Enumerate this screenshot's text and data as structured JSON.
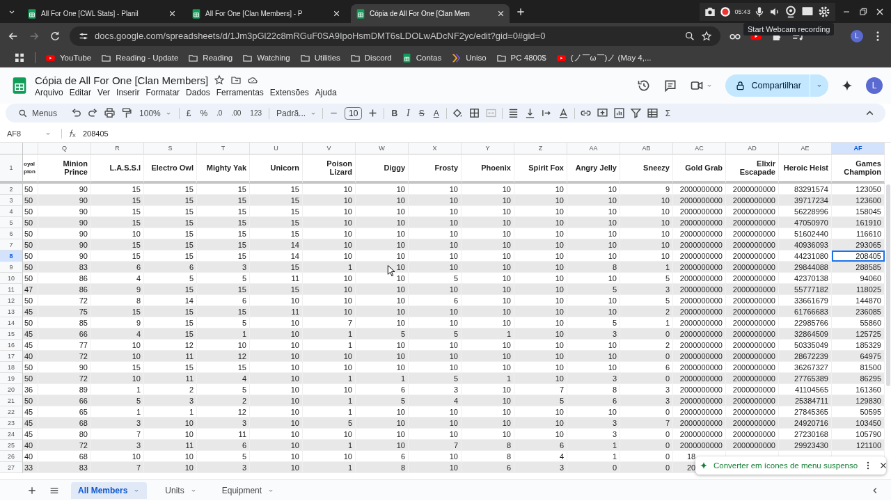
{
  "browser": {
    "tabs": [
      {
        "title": "All For One [CWL Stats] - Planil",
        "selected": false
      },
      {
        "title": "All For One [Clan Members] - P",
        "selected": false
      },
      {
        "title": "Cópia de All For One [Clan Mem",
        "selected": true
      }
    ],
    "recorder_time": "05:43",
    "tooltip": "Start Webcam recording",
    "url": "docs.google.com/spreadsheets/d/1Jm3pGl22c8mRGuF0SA9IpoHsmDMT6sLDOLwADcNF2yc/edit?gid=0#gid=0",
    "profile": "L",
    "bookmarks": [
      {
        "label": "YouTube",
        "kind": "youtube"
      },
      {
        "label": "Reading - Update",
        "kind": "folder"
      },
      {
        "label": "Reading",
        "kind": "folder"
      },
      {
        "label": "Watching",
        "kind": "folder"
      },
      {
        "label": "Utilities",
        "kind": "folder"
      },
      {
        "label": "Discord",
        "kind": "folder"
      },
      {
        "label": "Contas",
        "kind": "sheets"
      },
      {
        "label": "Uniso",
        "kind": "chevron"
      },
      {
        "label": "PC 4800$",
        "kind": "folder"
      },
      {
        "label": "(ノ￣ω￣)ノ (May 4,...",
        "kind": "youtube"
      }
    ]
  },
  "doc": {
    "title": "Cópia de All For One [Clan Members]",
    "menu": [
      "Arquivo",
      "Editar",
      "Ver",
      "Inserir",
      "Formatar",
      "Dados",
      "Ferramentas",
      "Extensões",
      "Ajuda"
    ],
    "share": "Compartilhar",
    "avatar": "L"
  },
  "toolbar": {
    "search": "Menus",
    "zoom": "100%",
    "currency": "£",
    "percent": "%",
    "dec_less": ".0",
    "dec_more": ".00",
    "number_format": "123",
    "font": "Padrã...",
    "font_size": "10",
    "bold": "B",
    "italic": "I",
    "strike": "S",
    "text_color": "A",
    "sum": "Σ"
  },
  "formula_bar": {
    "cell": "AF8",
    "value": "208405"
  },
  "table": {
    "columns": [
      {
        "header": "oyal pion",
        "selected": false
      },
      {
        "letter": "Q",
        "header": "Minion Prince",
        "selected": false
      },
      {
        "letter": "R",
        "header": "L.A.S.S.I",
        "selected": false
      },
      {
        "letter": "S",
        "header": "Electro Owl",
        "selected": false
      },
      {
        "letter": "T",
        "header": "Mighty Yak",
        "selected": false
      },
      {
        "letter": "U",
        "header": "Unicorn",
        "selected": false
      },
      {
        "letter": "V",
        "header": "Poison Lizard",
        "selected": false
      },
      {
        "letter": "W",
        "header": "Diggy",
        "selected": false
      },
      {
        "letter": "X",
        "header": "Frosty",
        "selected": false
      },
      {
        "letter": "Y",
        "header": "Phoenix",
        "selected": false
      },
      {
        "letter": "Z",
        "header": "Spirit Fox",
        "selected": false
      },
      {
        "letter": "AA",
        "header": "Angry Jelly",
        "selected": false
      },
      {
        "letter": "AB",
        "header": "Sneezy",
        "selected": false
      },
      {
        "letter": "AC",
        "header": "Gold Grab",
        "selected": false
      },
      {
        "letter": "AD",
        "header": "Elixir Escapade",
        "selected": false
      },
      {
        "letter": "AE",
        "header": "Heroic Heist",
        "selected": false
      },
      {
        "letter": "AF",
        "header": "Games Champion",
        "selected": true
      }
    ],
    "header_row": "1",
    "rows": [
      {
        "number": "2",
        "selected": false,
        "cells": [
          "50",
          "90",
          "15",
          "15",
          "15",
          "15",
          "10",
          "10",
          "10",
          "10",
          "10",
          "10",
          "9",
          "2000000000",
          "2000000000",
          "83291574",
          "123050"
        ]
      },
      {
        "number": "3",
        "selected": false,
        "cells": [
          "50",
          "90",
          "15",
          "15",
          "15",
          "15",
          "10",
          "10",
          "10",
          "10",
          "10",
          "10",
          "10",
          "2000000000",
          "2000000000",
          "39717234",
          "123600"
        ]
      },
      {
        "number": "4",
        "selected": false,
        "cells": [
          "50",
          "90",
          "15",
          "15",
          "15",
          "15",
          "10",
          "10",
          "10",
          "10",
          "10",
          "10",
          "10",
          "2000000000",
          "2000000000",
          "56228996",
          "158045"
        ]
      },
      {
        "number": "5",
        "selected": false,
        "cells": [
          "50",
          "90",
          "15",
          "15",
          "15",
          "15",
          "10",
          "10",
          "10",
          "10",
          "10",
          "10",
          "10",
          "2000000000",
          "2000000000",
          "47050970",
          "161910"
        ]
      },
      {
        "number": "6",
        "selected": false,
        "cells": [
          "50",
          "90",
          "10",
          "15",
          "15",
          "15",
          "10",
          "10",
          "10",
          "10",
          "10",
          "10",
          "10",
          "2000000000",
          "2000000000",
          "51602440",
          "116610"
        ]
      },
      {
        "number": "7",
        "selected": false,
        "cells": [
          "50",
          "90",
          "15",
          "15",
          "15",
          "14",
          "10",
          "10",
          "10",
          "10",
          "10",
          "10",
          "10",
          "2000000000",
          "2000000000",
          "40936093",
          "293065"
        ]
      },
      {
        "number": "8",
        "selected": true,
        "cells": [
          "50",
          "90",
          "15",
          "15",
          "15",
          "14",
          "10",
          "10",
          "10",
          "10",
          "10",
          "10",
          "10",
          "2000000000",
          "2000000000",
          "44231080",
          "208405"
        ]
      },
      {
        "number": "9",
        "selected": false,
        "cells": [
          "50",
          "83",
          "6",
          "6",
          "3",
          "15",
          "1",
          "10",
          "10",
          "10",
          "10",
          "8",
          "1",
          "2000000000",
          "2000000000",
          "29844088",
          "288585"
        ]
      },
      {
        "number": "10",
        "selected": false,
        "cells": [
          "50",
          "86",
          "4",
          "5",
          "5",
          "11",
          "10",
          "10",
          "5",
          "10",
          "10",
          "10",
          "5",
          "2000000000",
          "2000000000",
          "42370138",
          "94060"
        ]
      },
      {
        "number": "11",
        "selected": false,
        "cells": [
          "47",
          "86",
          "9",
          "15",
          "15",
          "15",
          "10",
          "10",
          "10",
          "10",
          "10",
          "5",
          "3",
          "2000000000",
          "2000000000",
          "55777182",
          "118025"
        ]
      },
      {
        "number": "12",
        "selected": false,
        "cells": [
          "50",
          "72",
          "8",
          "14",
          "6",
          "10",
          "10",
          "10",
          "6",
          "10",
          "10",
          "10",
          "5",
          "2000000000",
          "2000000000",
          "33661679",
          "144870"
        ]
      },
      {
        "number": "13",
        "selected": false,
        "cells": [
          "45",
          "75",
          "15",
          "15",
          "15",
          "11",
          "10",
          "10",
          "10",
          "10",
          "10",
          "10",
          "2",
          "2000000000",
          "2000000000",
          "61766683",
          "236085"
        ]
      },
      {
        "number": "14",
        "selected": false,
        "cells": [
          "50",
          "85",
          "9",
          "15",
          "5",
          "10",
          "7",
          "10",
          "10",
          "10",
          "10",
          "5",
          "1",
          "2000000000",
          "2000000000",
          "22985766",
          "55860"
        ]
      },
      {
        "number": "15",
        "selected": false,
        "cells": [
          "45",
          "66",
          "4",
          "15",
          "1",
          "10",
          "1",
          "5",
          "5",
          "1",
          "10",
          "3",
          "0",
          "2000000000",
          "2000000000",
          "32864509",
          "125725"
        ]
      },
      {
        "number": "16",
        "selected": false,
        "cells": [
          "45",
          "77",
          "10",
          "12",
          "10",
          "10",
          "1",
          "10",
          "10",
          "10",
          "10",
          "10",
          "2",
          "2000000000",
          "2000000000",
          "50335049",
          "185329"
        ]
      },
      {
        "number": "17",
        "selected": false,
        "cells": [
          "40",
          "72",
          "10",
          "11",
          "12",
          "10",
          "10",
          "10",
          "10",
          "10",
          "10",
          "10",
          "0",
          "2000000000",
          "2000000000",
          "28672239",
          "64975"
        ]
      },
      {
        "number": "18",
        "selected": false,
        "cells": [
          "50",
          "90",
          "15",
          "15",
          "15",
          "10",
          "10",
          "10",
          "10",
          "10",
          "10",
          "10",
          "6",
          "2000000000",
          "2000000000",
          "36267327",
          "81500"
        ]
      },
      {
        "number": "19",
        "selected": false,
        "cells": [
          "50",
          "72",
          "10",
          "11",
          "4",
          "10",
          "1",
          "1",
          "5",
          "1",
          "10",
          "3",
          "0",
          "2000000000",
          "2000000000",
          "27765389",
          "86295"
        ]
      },
      {
        "number": "20",
        "selected": false,
        "cells": [
          "36",
          "89",
          "1",
          "2",
          "5",
          "10",
          "10",
          "6",
          "3",
          "10",
          "7",
          "8",
          "3",
          "2000000000",
          "2000000000",
          "41104565",
          "161360"
        ]
      },
      {
        "number": "21",
        "selected": false,
        "cells": [
          "50",
          "66",
          "5",
          "3",
          "2",
          "10",
          "1",
          "5",
          "4",
          "10",
          "5",
          "6",
          "3",
          "2000000000",
          "2000000000",
          "25384711",
          "129830"
        ]
      },
      {
        "number": "22",
        "selected": false,
        "cells": [
          "45",
          "65",
          "1",
          "1",
          "12",
          "10",
          "1",
          "10",
          "10",
          "10",
          "10",
          "10",
          "0",
          "2000000000",
          "2000000000",
          "27845365",
          "50595"
        ]
      },
      {
        "number": "23",
        "selected": false,
        "cells": [
          "45",
          "68",
          "3",
          "10",
          "3",
          "10",
          "5",
          "10",
          "10",
          "10",
          "10",
          "3",
          "7",
          "2000000000",
          "2000000000",
          "24920716",
          "103450"
        ]
      },
      {
        "number": "24",
        "selected": false,
        "cells": [
          "45",
          "80",
          "7",
          "10",
          "11",
          "10",
          "10",
          "10",
          "10",
          "10",
          "10",
          "3",
          "0",
          "2000000000",
          "2000000000",
          "27230168",
          "105790"
        ]
      },
      {
        "number": "25",
        "selected": false,
        "cells": [
          "40",
          "72",
          "3",
          "11",
          "6",
          "10",
          "1",
          "10",
          "7",
          "8",
          "6",
          "1",
          "0",
          "2000000000",
          "2000000000",
          "29923430",
          "121100"
        ]
      },
      {
        "number": "26",
        "selected": false,
        "cells": [
          "40",
          "68",
          "10",
          "10",
          "5",
          "10",
          "10",
          "6",
          "10",
          "8",
          "4",
          "1",
          "0",
          "18"
        ]
      },
      {
        "number": "27",
        "selected": false,
        "cells": [
          "33",
          "83",
          "7",
          "10",
          "3",
          "10",
          "1",
          "8",
          "10",
          "6",
          "3",
          "0",
          "0",
          "20"
        ]
      }
    ]
  },
  "sheets": [
    {
      "label": "All Members",
      "selected": true
    },
    {
      "label": "Units",
      "selected": false
    },
    {
      "label": "Equipment",
      "selected": false
    }
  ],
  "popup": {
    "text": "Converter em ícones de menu suspenso"
  }
}
